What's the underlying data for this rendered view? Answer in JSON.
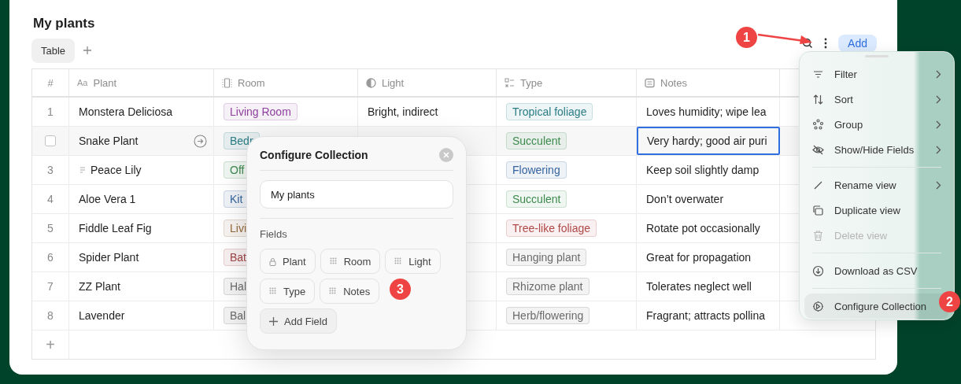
{
  "page_title": "My plants",
  "view_tabs": [
    {
      "label": "Table",
      "selected": true
    }
  ],
  "toolbar": {
    "add_button": "Add"
  },
  "table": {
    "columns": [
      {
        "label": "#",
        "kind": "index"
      },
      {
        "label": "Plant",
        "kind": "title",
        "glyph": "Aa"
      },
      {
        "label": "Room",
        "kind": "room"
      },
      {
        "label": "Light",
        "kind": "light"
      },
      {
        "label": "Type",
        "kind": "type"
      },
      {
        "label": "Notes",
        "kind": "notes"
      }
    ],
    "rows": [
      {
        "index": "1",
        "hovered": false,
        "has_page": false,
        "plant": "Monstera Deliciosa",
        "room": {
          "label": "Living Room",
          "color": "#8e3f9e"
        },
        "light": "Bright, indirect",
        "type": {
          "label": "Tropical foliage",
          "color": "#2b7d86"
        },
        "notes": "Loves humidity; wipe lea",
        "notes_selected": false
      },
      {
        "hovered": true,
        "has_page": false,
        "plant": "Snake Plant",
        "room": {
          "label": "Bedr",
          "color": "#2b7d86"
        },
        "type": {
          "label": "Succulent",
          "color": "#3d8a4f"
        },
        "notes": "Very hardy; good air puri",
        "notes_selected": true
      },
      {
        "index": "3",
        "hovered": false,
        "has_page": true,
        "plant": "Peace Lily",
        "room": {
          "label": "Off",
          "color": "#3d8a4f"
        },
        "type": {
          "label": "Flowering",
          "color": "#35649e"
        },
        "notes": "Keep soil slightly damp",
        "notes_selected": false
      },
      {
        "index": "4",
        "hovered": false,
        "has_page": false,
        "plant": "Aloe Vera 1",
        "room": {
          "label": "Kit",
          "color": "#35649e"
        },
        "type": {
          "label": "Succulent",
          "color": "#3d8a4f"
        },
        "notes": "Don’t overwater",
        "notes_selected": false
      },
      {
        "index": "5",
        "hovered": false,
        "has_page": false,
        "plant": "Fiddle Leaf Fig",
        "room": {
          "label": "Livi",
          "color": "#95693a"
        },
        "type": {
          "label": "Tree-like foliage",
          "color": "#b04848"
        },
        "notes": "Rotate pot occasionally",
        "notes_selected": false
      },
      {
        "index": "6",
        "hovered": false,
        "has_page": false,
        "plant": "Spider Plant",
        "room": {
          "label": "Bat",
          "color": "#a04545"
        },
        "type": {
          "label": "Hanging plant",
          "color": "#6b6b6b"
        },
        "notes": "Great for propagation",
        "notes_selected": false
      },
      {
        "index": "7",
        "hovered": false,
        "has_page": false,
        "plant": "ZZ Plant",
        "room": {
          "label": "Hal",
          "color": "#6b6b6b"
        },
        "type": {
          "label": "Rhizome plant",
          "color": "#6b6b6b"
        },
        "notes": "Tolerates neglect well",
        "notes_selected": false
      },
      {
        "index": "8",
        "hovered": false,
        "has_page": false,
        "plant": "Lavender",
        "room": {
          "label": "Bal",
          "color": "#6b6b6b"
        },
        "type": {
          "label": "Herb/flowering",
          "color": "#6b6b6b"
        },
        "notes": "Fragrant; attracts pollina",
        "notes_selected": false
      }
    ],
    "add_row": "+"
  },
  "menu": {
    "sections": [
      [
        {
          "label": "Filter",
          "kind": "filter",
          "submenu": true,
          "disabled": false,
          "highlighted": false
        },
        {
          "label": "Sort",
          "kind": "sort",
          "submenu": true,
          "disabled": false,
          "highlighted": false
        },
        {
          "label": "Group",
          "kind": "group",
          "submenu": true,
          "disabled": false,
          "highlighted": false
        },
        {
          "label": "Show/Hide Fields",
          "kind": "visibility",
          "submenu": true,
          "disabled": false,
          "highlighted": false
        }
      ],
      [
        {
          "label": "Rename view",
          "kind": "rename",
          "submenu": true,
          "disabled": false,
          "highlighted": false
        },
        {
          "label": "Duplicate view",
          "kind": "duplicate",
          "submenu": false,
          "disabled": false,
          "highlighted": false
        },
        {
          "label": "Delete view",
          "kind": "delete",
          "submenu": false,
          "disabled": true,
          "highlighted": false
        }
      ],
      [
        {
          "label": "Download as CSV",
          "kind": "download",
          "submenu": false,
          "disabled": false,
          "highlighted": false
        }
      ],
      [
        {
          "label": "Configure Collection",
          "kind": "configure",
          "submenu": false,
          "disabled": false,
          "highlighted": true
        }
      ]
    ]
  },
  "dialog": {
    "title": "Configure Collection",
    "name_value": "My plants",
    "fields_label": "Fields",
    "fields": [
      {
        "label": "Plant",
        "locked": true
      },
      {
        "label": "Room",
        "locked": false
      },
      {
        "label": "Light",
        "locked": false
      },
      {
        "label": "Type",
        "locked": false
      },
      {
        "label": "Notes",
        "locked": false
      }
    ],
    "add_field": "Add Field"
  },
  "annotations": [
    {
      "label": "1"
    },
    {
      "label": "2"
    },
    {
      "label": "3"
    }
  ]
}
